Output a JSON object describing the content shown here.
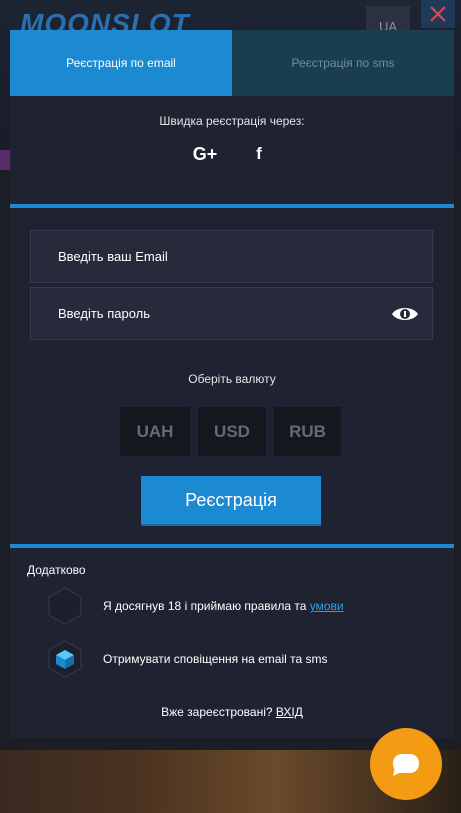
{
  "background": {
    "logo": "MOONSLOT",
    "lang": "UA"
  },
  "tabs": [
    {
      "label": "Реєстрація по email",
      "active": true
    },
    {
      "label": "Реєстрація по sms",
      "active": false
    }
  ],
  "quick_signup": {
    "title": "Швидка реєстрація через:",
    "socials": [
      {
        "label": "G+",
        "icon": "google-plus-icon"
      },
      {
        "label": "f",
        "icon": "facebook-icon"
      }
    ]
  },
  "form": {
    "email_placeholder": "Введіть ваш Email",
    "password_placeholder": "Введіть пароль",
    "currency_label": "Оберіть валюту",
    "currencies": [
      "UAH",
      "USD",
      "RUB"
    ],
    "submit_label": "Реєстрація"
  },
  "extra": {
    "title": "Додатково",
    "terms_text": "Я досягнув 18 і приймаю правила та ",
    "terms_link": "умови",
    "notify_text": "Отримувати сповіщення на email та sms",
    "login_text": "Вже зареєстровані? ",
    "login_link": "ВХІД"
  },
  "colors": {
    "accent": "#1b8ad0",
    "modal_bg": "#1f2230",
    "chat_button": "#f39b12"
  }
}
